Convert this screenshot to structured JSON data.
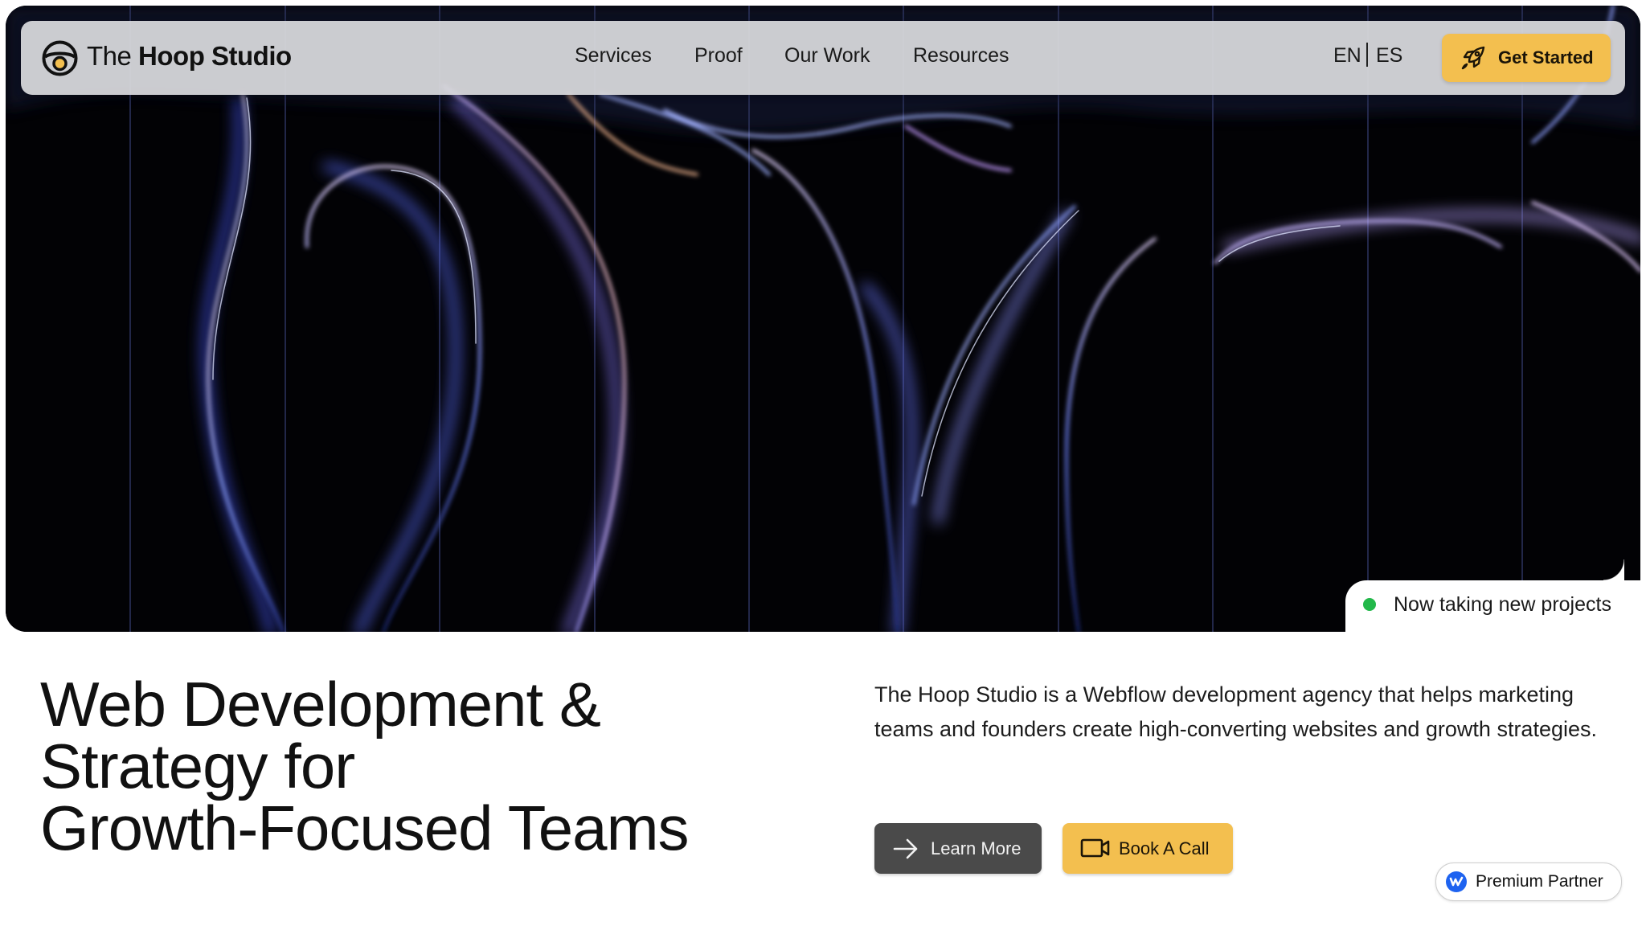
{
  "header": {
    "brand_prefix": "The",
    "brand_name": "Hoop Studio",
    "nav": [
      "Services",
      "Proof",
      "Our Work",
      "Resources"
    ],
    "lang_en": "EN",
    "lang_es": "ES",
    "cta_label": "Get Started"
  },
  "hero": {
    "status_text": "Now taking new projects",
    "status_color": "#22b84a"
  },
  "main": {
    "headline_lines": [
      "Web Development &",
      "Strategy for",
      "Growth-Focused Teams"
    ],
    "description": "The Hoop Studio is a Webflow development agency that helps marketing teams and founders create high-converting websites and growth strategies.",
    "learn_more_label": "Learn More",
    "book_call_label": "Book A Call"
  },
  "badge": {
    "label": "Premium Partner"
  },
  "colors": {
    "accent": "#f3bf4f",
    "dark_button": "#4a4a4a",
    "hero_background": "#020205",
    "webflow_blue": "#1e63f0"
  },
  "icons": [
    "logo-icon",
    "rocket-icon",
    "arrow-right-icon",
    "video-camera-icon",
    "webflow-icon"
  ]
}
